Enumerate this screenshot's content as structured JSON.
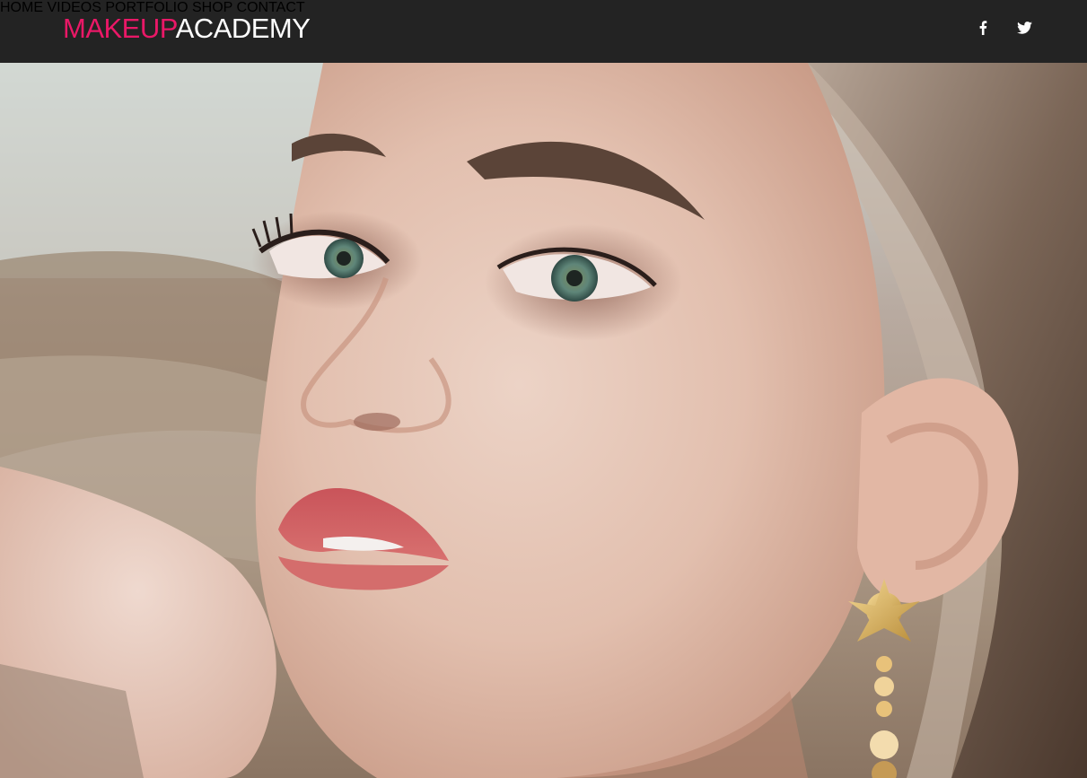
{
  "brand": {
    "accent": "MAKEUP",
    "main": "ACADEMY",
    "accent_color": "#ea1867"
  },
  "nav": {
    "items": [
      {
        "label": "HOME"
      },
      {
        "label": "VIDEOS"
      },
      {
        "label": "PORTFOLIO"
      },
      {
        "label": "SHOP"
      },
      {
        "label": "CONTACT"
      }
    ]
  },
  "social": [
    {
      "icon": "facebook-icon"
    },
    {
      "icon": "twitter-icon"
    }
  ],
  "hero": {
    "image": "portrait-photo"
  }
}
